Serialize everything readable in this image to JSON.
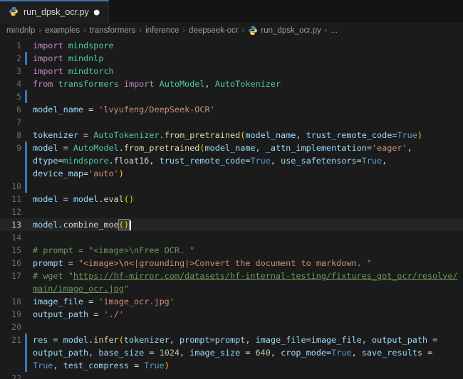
{
  "tab": {
    "title": "run_dpsk_ocr.py",
    "dirty_dot": "●"
  },
  "breadcrumbs": {
    "separator": "›",
    "items": [
      {
        "label": "mindnlp",
        "icon": false
      },
      {
        "label": "examples",
        "icon": false
      },
      {
        "label": "transformers",
        "icon": false
      },
      {
        "label": "inference",
        "icon": false
      },
      {
        "label": "deepseek-ocr",
        "icon": false
      },
      {
        "label": "run_dpsk_ocr.py",
        "icon": true
      },
      {
        "label": "...",
        "icon": false
      }
    ]
  },
  "colors": {
    "accent_tab_border": "#3d74b4",
    "modified_gutter": "#3776c4",
    "editor_bg": "#1b1b1b",
    "keyword": "#c586c0",
    "class": "#4ec9b0",
    "function": "#dcdcaa",
    "variable": "#9cdcfe",
    "string": "#ce9178",
    "comment": "#6a9955",
    "number": "#b5cea8",
    "constant": "#569cd6",
    "bracket": "#ffd700"
  },
  "editor": {
    "lines": [
      {
        "num": "1",
        "segments": [
          {
            "t": "import",
            "c": "kw"
          },
          {
            "t": " ",
            "c": "pl"
          },
          {
            "t": "mindspore",
            "c": "cls"
          }
        ]
      },
      {
        "num": "2",
        "modified": true,
        "segments": [
          {
            "t": "import",
            "c": "kw"
          },
          {
            "t": " ",
            "c": "pl"
          },
          {
            "t": "mindnlp",
            "c": "cls"
          }
        ]
      },
      {
        "num": "3",
        "segments": [
          {
            "t": "import",
            "c": "kw"
          },
          {
            "t": " ",
            "c": "pl"
          },
          {
            "t": "mindtorch",
            "c": "cls"
          }
        ]
      },
      {
        "num": "4",
        "segments": [
          {
            "t": "from",
            "c": "kw"
          },
          {
            "t": " ",
            "c": "pl"
          },
          {
            "t": "transformers",
            "c": "cls"
          },
          {
            "t": " ",
            "c": "pl"
          },
          {
            "t": "import",
            "c": "kw"
          },
          {
            "t": " ",
            "c": "pl"
          },
          {
            "t": "AutoModel",
            "c": "cls"
          },
          {
            "t": ", ",
            "c": "pl"
          },
          {
            "t": "AutoTokenizer",
            "c": "cls"
          }
        ]
      },
      {
        "num": "5",
        "modified": true,
        "segments": []
      },
      {
        "num": "6",
        "segments": [
          {
            "t": "model_name",
            "c": "var"
          },
          {
            "t": " = ",
            "c": "pl"
          },
          {
            "t": "'lvyufeng/DeepSeek-OCR'",
            "c": "str"
          }
        ]
      },
      {
        "num": "7",
        "segments": []
      },
      {
        "num": "8",
        "segments": [
          {
            "t": "tokenizer",
            "c": "var"
          },
          {
            "t": " = ",
            "c": "pl"
          },
          {
            "t": "AutoTokenizer",
            "c": "cls"
          },
          {
            "t": ".",
            "c": "pl"
          },
          {
            "t": "from_pretrained",
            "c": "fn"
          },
          {
            "t": "(",
            "c": "br"
          },
          {
            "t": "model_name",
            "c": "var"
          },
          {
            "t": ", ",
            "c": "pl"
          },
          {
            "t": "trust_remote_code",
            "c": "var"
          },
          {
            "t": "=",
            "c": "pl"
          },
          {
            "t": "True",
            "c": "tru"
          },
          {
            "t": ")",
            "c": "br"
          }
        ]
      },
      {
        "num": "9",
        "modified": true,
        "segments": [
          {
            "t": "model",
            "c": "var"
          },
          {
            "t": " = ",
            "c": "pl"
          },
          {
            "t": "AutoModel",
            "c": "cls"
          },
          {
            "t": ".",
            "c": "pl"
          },
          {
            "t": "from_pretrained",
            "c": "fn"
          },
          {
            "t": "(",
            "c": "br"
          },
          {
            "t": "model_name",
            "c": "var"
          },
          {
            "t": ", ",
            "c": "pl"
          },
          {
            "t": "_attn_implementation",
            "c": "var"
          },
          {
            "t": "=",
            "c": "pl"
          },
          {
            "t": "'eager'",
            "c": "str"
          },
          {
            "t": ",",
            "c": "pl"
          }
        ]
      },
      {
        "num": "",
        "modified": true,
        "segments": [
          {
            "t": "dtype",
            "c": "var"
          },
          {
            "t": "=",
            "c": "pl"
          },
          {
            "t": "mindspore",
            "c": "cls"
          },
          {
            "t": ".",
            "c": "pl"
          },
          {
            "t": "float16",
            "c": "pl"
          },
          {
            "t": ", ",
            "c": "pl"
          },
          {
            "t": "trust_remote_code",
            "c": "var"
          },
          {
            "t": "=",
            "c": "pl"
          },
          {
            "t": "True",
            "c": "tru"
          },
          {
            "t": ", ",
            "c": "pl"
          },
          {
            "t": "use_safetensors",
            "c": "var"
          },
          {
            "t": "=",
            "c": "pl"
          },
          {
            "t": "True",
            "c": "tru"
          },
          {
            "t": ",",
            "c": "pl"
          }
        ]
      },
      {
        "num": "",
        "modified": true,
        "segments": [
          {
            "t": "device_map",
            "c": "var"
          },
          {
            "t": "=",
            "c": "pl"
          },
          {
            "t": "'auto'",
            "c": "str"
          },
          {
            "t": ")",
            "c": "br"
          }
        ]
      },
      {
        "num": "10",
        "modified": true,
        "segments": []
      },
      {
        "num": "11",
        "segments": [
          {
            "t": "model",
            "c": "var"
          },
          {
            "t": " = ",
            "c": "pl"
          },
          {
            "t": "model",
            "c": "var"
          },
          {
            "t": ".",
            "c": "pl"
          },
          {
            "t": "eval",
            "c": "fn"
          },
          {
            "t": "()",
            "c": "br"
          }
        ]
      },
      {
        "num": "12",
        "segments": []
      },
      {
        "num": "13",
        "current": true,
        "cursor": true,
        "segments": [
          {
            "t": "model",
            "c": "var"
          },
          {
            "t": ".",
            "c": "pl"
          },
          {
            "t": "combine_moe",
            "c": "wh"
          },
          {
            "t": "()",
            "c": "brbox"
          }
        ]
      },
      {
        "num": "14",
        "segments": []
      },
      {
        "num": "15",
        "segments": [
          {
            "t": "# prompt = \"<image>\\nFree OCR. \"",
            "c": "com"
          }
        ]
      },
      {
        "num": "16",
        "segments": [
          {
            "t": "prompt",
            "c": "var"
          },
          {
            "t": " = ",
            "c": "pl"
          },
          {
            "t": "\"<image>",
            "c": "str"
          },
          {
            "t": "\\n",
            "c": "esc"
          },
          {
            "t": "<|grounding|>Convert the document to markdown. \"",
            "c": "str"
          }
        ]
      },
      {
        "num": "17",
        "segments": [
          {
            "t": "# wget \"",
            "c": "com"
          },
          {
            "t": "https://hf-mirror.com/datasets/hf-internal-testing/fixtures_got_ocr/resolve/",
            "c": "lnk"
          }
        ]
      },
      {
        "num": "",
        "segments": [
          {
            "t": "main/image_ocr.jpg",
            "c": "lnk"
          },
          {
            "t": "\"",
            "c": "com"
          }
        ]
      },
      {
        "num": "18",
        "segments": [
          {
            "t": "image_file",
            "c": "var"
          },
          {
            "t": " = ",
            "c": "pl"
          },
          {
            "t": "'image_ocr.jpg'",
            "c": "str"
          }
        ]
      },
      {
        "num": "19",
        "segments": [
          {
            "t": "output_path",
            "c": "var"
          },
          {
            "t": " = ",
            "c": "pl"
          },
          {
            "t": "'./'",
            "c": "str"
          }
        ]
      },
      {
        "num": "20",
        "segments": []
      },
      {
        "num": "21",
        "modified": true,
        "segments": [
          {
            "t": "res",
            "c": "var"
          },
          {
            "t": " = ",
            "c": "pl"
          },
          {
            "t": "model",
            "c": "var"
          },
          {
            "t": ".",
            "c": "pl"
          },
          {
            "t": "infer",
            "c": "fn"
          },
          {
            "t": "(",
            "c": "br"
          },
          {
            "t": "tokenizer",
            "c": "var"
          },
          {
            "t": ", ",
            "c": "pl"
          },
          {
            "t": "prompt",
            "c": "var"
          },
          {
            "t": "=",
            "c": "pl"
          },
          {
            "t": "prompt",
            "c": "var"
          },
          {
            "t": ", ",
            "c": "pl"
          },
          {
            "t": "image_file",
            "c": "var"
          },
          {
            "t": "=",
            "c": "pl"
          },
          {
            "t": "image_file",
            "c": "var"
          },
          {
            "t": ", ",
            "c": "pl"
          },
          {
            "t": "output_path",
            "c": "var"
          },
          {
            "t": " =",
            "c": "pl"
          }
        ]
      },
      {
        "num": "",
        "modified": true,
        "segments": [
          {
            "t": "output_path",
            "c": "var"
          },
          {
            "t": ", ",
            "c": "pl"
          },
          {
            "t": "base_size",
            "c": "var"
          },
          {
            "t": " = ",
            "c": "pl"
          },
          {
            "t": "1024",
            "c": "num"
          },
          {
            "t": ", ",
            "c": "pl"
          },
          {
            "t": "image_size",
            "c": "var"
          },
          {
            "t": " = ",
            "c": "pl"
          },
          {
            "t": "640",
            "c": "num"
          },
          {
            "t": ", ",
            "c": "pl"
          },
          {
            "t": "crop_mode",
            "c": "var"
          },
          {
            "t": "=",
            "c": "pl"
          },
          {
            "t": "True",
            "c": "tru"
          },
          {
            "t": ", ",
            "c": "pl"
          },
          {
            "t": "save_results",
            "c": "var"
          },
          {
            "t": " =",
            "c": "pl"
          }
        ]
      },
      {
        "num": "",
        "modified": true,
        "segments": [
          {
            "t": "True",
            "c": "tru"
          },
          {
            "t": ", ",
            "c": "pl"
          },
          {
            "t": "test_compress",
            "c": "var"
          },
          {
            "t": " = ",
            "c": "pl"
          },
          {
            "t": "True",
            "c": "tru"
          },
          {
            "t": ")",
            "c": "br"
          }
        ]
      },
      {
        "num": "22",
        "segments": []
      }
    ]
  }
}
